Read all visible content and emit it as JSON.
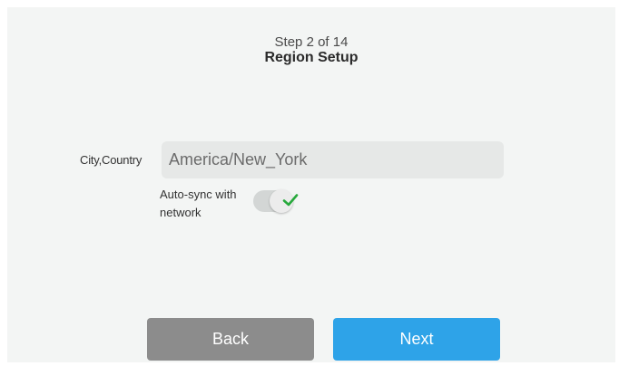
{
  "header": {
    "step": "Step 2 of 14",
    "title": "Region Setup"
  },
  "region": {
    "city_label": "City,Country",
    "city_value": "America/New_York"
  },
  "autosync": {
    "label": "Auto-sync with network",
    "enabled": true,
    "check_icon": "check-icon"
  },
  "footer": {
    "back_label": "Back",
    "next_label": "Next"
  },
  "colors": {
    "accent": "#2ea3e8",
    "back_button": "#8c8c8c",
    "check": "#27a93c",
    "background": "#f3f5f4"
  }
}
